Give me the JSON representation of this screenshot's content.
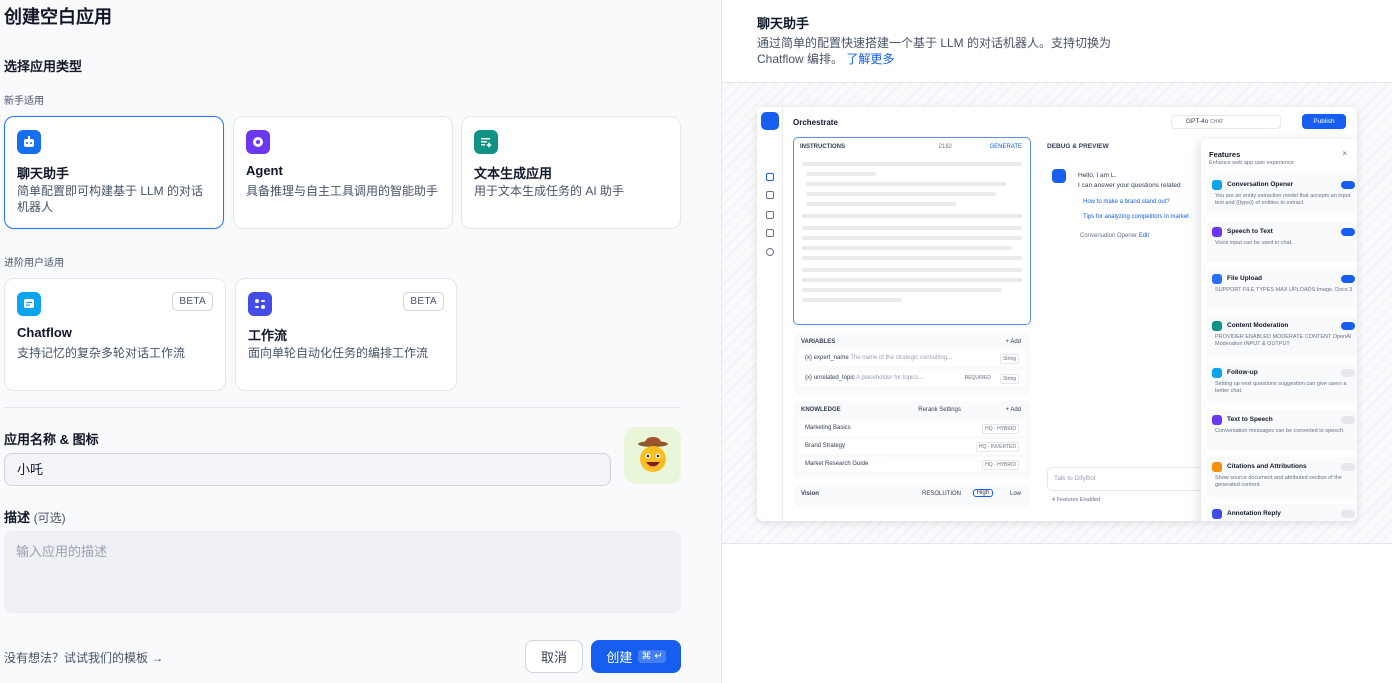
{
  "title": "创建空白应用",
  "section_app_type": "选择应用类型",
  "groups": {
    "beginner": "新手适用",
    "advanced": "进阶用户适用"
  },
  "cards": {
    "chat": {
      "title": "聊天助手",
      "desc": "简单配置即可构建基于 LLM 的对话机器人",
      "color": "#1570ef"
    },
    "agent": {
      "title": "Agent",
      "desc": "具备推理与自主工具调用的智能助手",
      "color": "#6938ef"
    },
    "textgen": {
      "title": "文本生成应用",
      "desc": "用于文本生成任务的 AI 助手",
      "color": "#0e9384"
    },
    "chatflow": {
      "title": "Chatflow",
      "desc": "支持记忆的复杂多轮对话工作流",
      "badge": "BETA",
      "color": "#0ba5ec"
    },
    "workflow": {
      "title": "工作流",
      "desc": "面向单轮自动化任务的编排工作流",
      "badge": "BETA",
      "color": "#444ce7"
    }
  },
  "form": {
    "name_label": "应用名称 & 图标",
    "name_value": "小吒",
    "desc_label": "描述",
    "desc_optional": "(可选)",
    "desc_placeholder": "输入应用的描述"
  },
  "footer": {
    "template_link": "没有想法？试试我们的模板 →",
    "cancel": "取消",
    "create": "创建",
    "create_shortcut": "⌘ ↵"
  },
  "preview": {
    "title": "聊天助手",
    "desc": "通过简单的配置快速搭建一个基于 LLM 的对话机器人。支持切换为 Chatflow 编排。",
    "learn_more": "了解更多",
    "mock": {
      "header": "Orchestrate",
      "model": "GPT-4o",
      "model_tag": "CHAT",
      "publish": "Publish",
      "instructions": "INSTRUCTIONS",
      "instructions_count": "2182",
      "generate": "GENERATE",
      "variables": "VARIABLES",
      "add": "+ Add",
      "var_rows": [
        {
          "name": "{x} expert_name",
          "hint": "The name of the strategic consulting...",
          "type": "String"
        },
        {
          "name": "{x} unrelated_topic",
          "hint": "A placeholder for topics...",
          "type": "String"
        }
      ],
      "var_required": "REQUIRED",
      "knowledge": "KNOWLEDGE",
      "rerank": "Rerank Settings",
      "knowledge_rows": [
        {
          "name": "Marketing Basics",
          "tag": "HQ · HYBRID"
        },
        {
          "name": "Brand Strategy",
          "tag": "HQ · INVERTED"
        },
        {
          "name": "Market Research Guide",
          "tag": "HQ · HYBRID"
        }
      ],
      "vision": "Vision",
      "resolution": "RESOLUTION",
      "high": "High",
      "low": "Low",
      "debug": "DEBUG & PREVIEW",
      "hello_1": "Hello, I am L.",
      "hello_2": "I can answer your questions related",
      "q1": "How to make a brand stand out?",
      "q2": "Tips for analyzing competitors in market",
      "opener_label": "Conversation Opener",
      "opener_edit": "Edit",
      "talk": "Talk to DifyBot",
      "features_enabled": "4 Features Enabled",
      "features_title": "Features",
      "features_sub": "Enhance web app user experience",
      "features": [
        {
          "title": "Conversation Opener",
          "desc": "You are an entity extraction model that accepts an input text and {{type}} of entities to extract.",
          "on": true,
          "color": "#0ba5ec"
        },
        {
          "title": "Speech to Text",
          "desc": "Voice input can be used in chat.",
          "on": true,
          "color": "#6938ef"
        },
        {
          "title": "File Upload",
          "desc": "SUPPORT FILE TYPES  MAX UPLOADS  Image, Docs  3",
          "on": true,
          "color": "#2970ff"
        },
        {
          "title": "Content Moderation",
          "desc": "PROVIDER  ENABLED MODERATE CONTENT  OpenAI Moderation  INPUT & OUTPUT",
          "on": true,
          "color": "#0e9384"
        },
        {
          "title": "Follow-up",
          "desc": "Setting up next questions suggestion can give users a better chat.",
          "on": false,
          "color": "#0ba5ec"
        },
        {
          "title": "Text to Speech",
          "desc": "Conversation messages can be converted to speech.",
          "on": false,
          "color": "#6938ef"
        },
        {
          "title": "Citations and Attributions",
          "desc": "Show source document and attributed section of the generated content.",
          "on": false,
          "color": "#f79009"
        },
        {
          "title": "Annotation Reply",
          "desc": "",
          "on": false,
          "color": "#444ce7"
        }
      ]
    }
  }
}
